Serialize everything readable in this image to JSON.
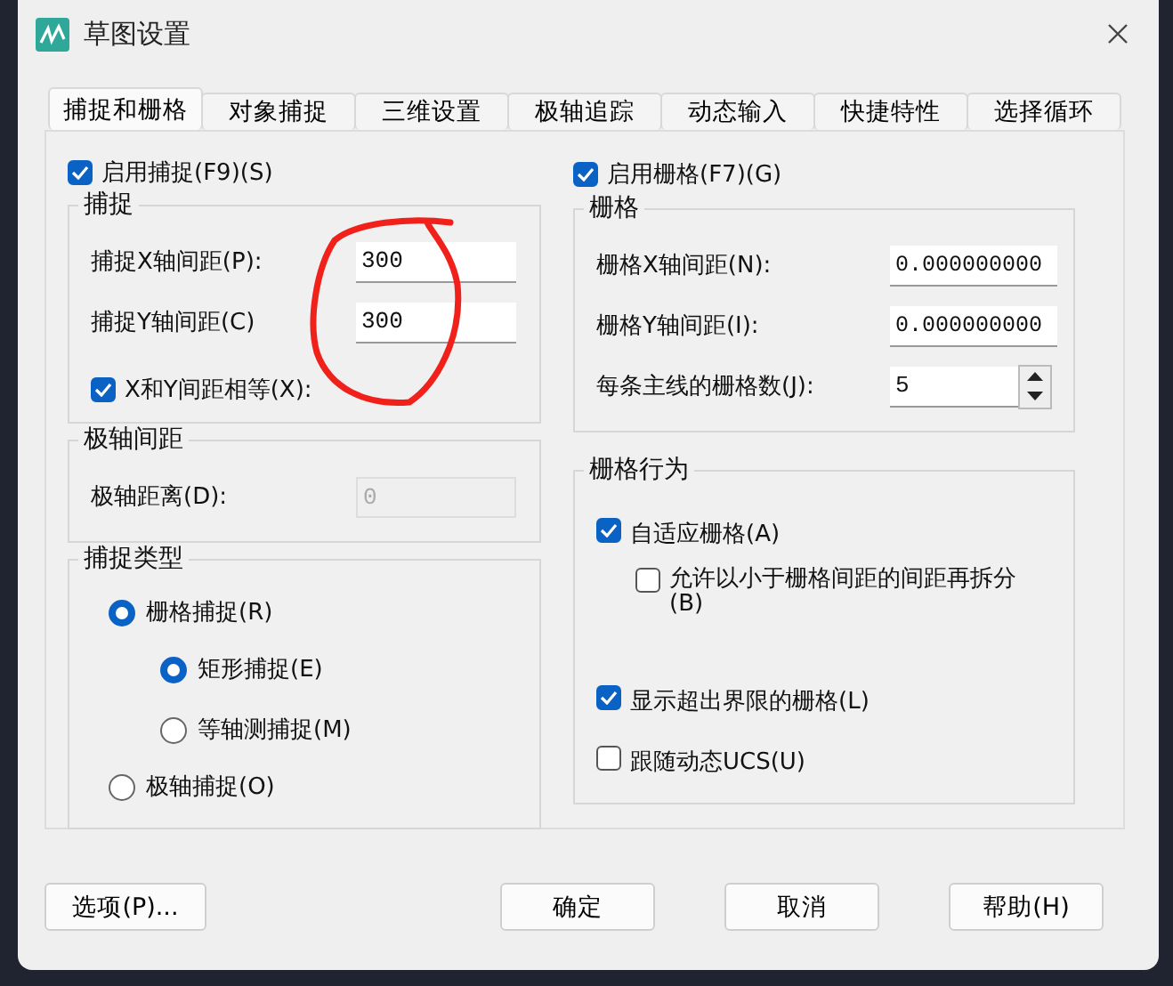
{
  "window": {
    "title": "草图设置"
  },
  "tabs": [
    {
      "label": "捕捉和栅格",
      "selected": true
    },
    {
      "label": "对象捕捉",
      "selected": false
    },
    {
      "label": "三维设置",
      "selected": false
    },
    {
      "label": "极轴追踪",
      "selected": false
    },
    {
      "label": "动态输入",
      "selected": false
    },
    {
      "label": "快捷特性",
      "selected": false
    },
    {
      "label": "选择循环",
      "selected": false
    }
  ],
  "snap_enable": {
    "label": "启用捕捉(F9)(S)",
    "checked": true
  },
  "snap_group": {
    "title": "捕捉",
    "fields": [
      {
        "label": "捕捉X轴间距(P):",
        "value": "300"
      },
      {
        "label": "捕捉Y轴间距(C)",
        "value": "300"
      }
    ],
    "equal": {
      "label": "X和Y间距相等(X):",
      "checked": true
    }
  },
  "polar_group": {
    "title": "极轴间距",
    "field": {
      "label": "极轴距离(D):",
      "value": "0",
      "disabled": true
    }
  },
  "snap_type": {
    "title": "捕捉类型",
    "options": [
      {
        "label": "栅格捕捉(R)",
        "selected": true,
        "children": [
          {
            "label": "矩形捕捉(E)",
            "selected": true
          },
          {
            "label": "等轴测捕捉(M)",
            "selected": false
          }
        ]
      },
      {
        "label": "极轴捕捉(O)",
        "selected": false
      }
    ]
  },
  "grid_enable": {
    "label": "启用栅格(F7)(G)",
    "checked": true
  },
  "grid_group": {
    "title": "栅格",
    "fields": [
      {
        "label": "栅格X轴间距(N):",
        "value": "0.000000000"
      },
      {
        "label": "栅格Y轴间距(I):",
        "value": "0.000000000"
      }
    ],
    "spinner": {
      "label": "每条主线的栅格数(J):",
      "value": "5"
    }
  },
  "grid_behavior": {
    "title": "栅格行为",
    "options": [
      {
        "label": "自适应栅格(A)",
        "checked": true,
        "children": [
          {
            "label": "允许以小于栅格间距的间距再拆分(B)",
            "checked": false
          }
        ]
      },
      {
        "label": "显示超出界限的栅格(L)",
        "checked": true
      },
      {
        "label": "跟随动态UCS(U)",
        "checked": false
      }
    ]
  },
  "buttons": [
    {
      "label": "选项(P)..."
    },
    {
      "label": "确定"
    },
    {
      "label": "取消"
    },
    {
      "label": "帮助(H)"
    }
  ]
}
